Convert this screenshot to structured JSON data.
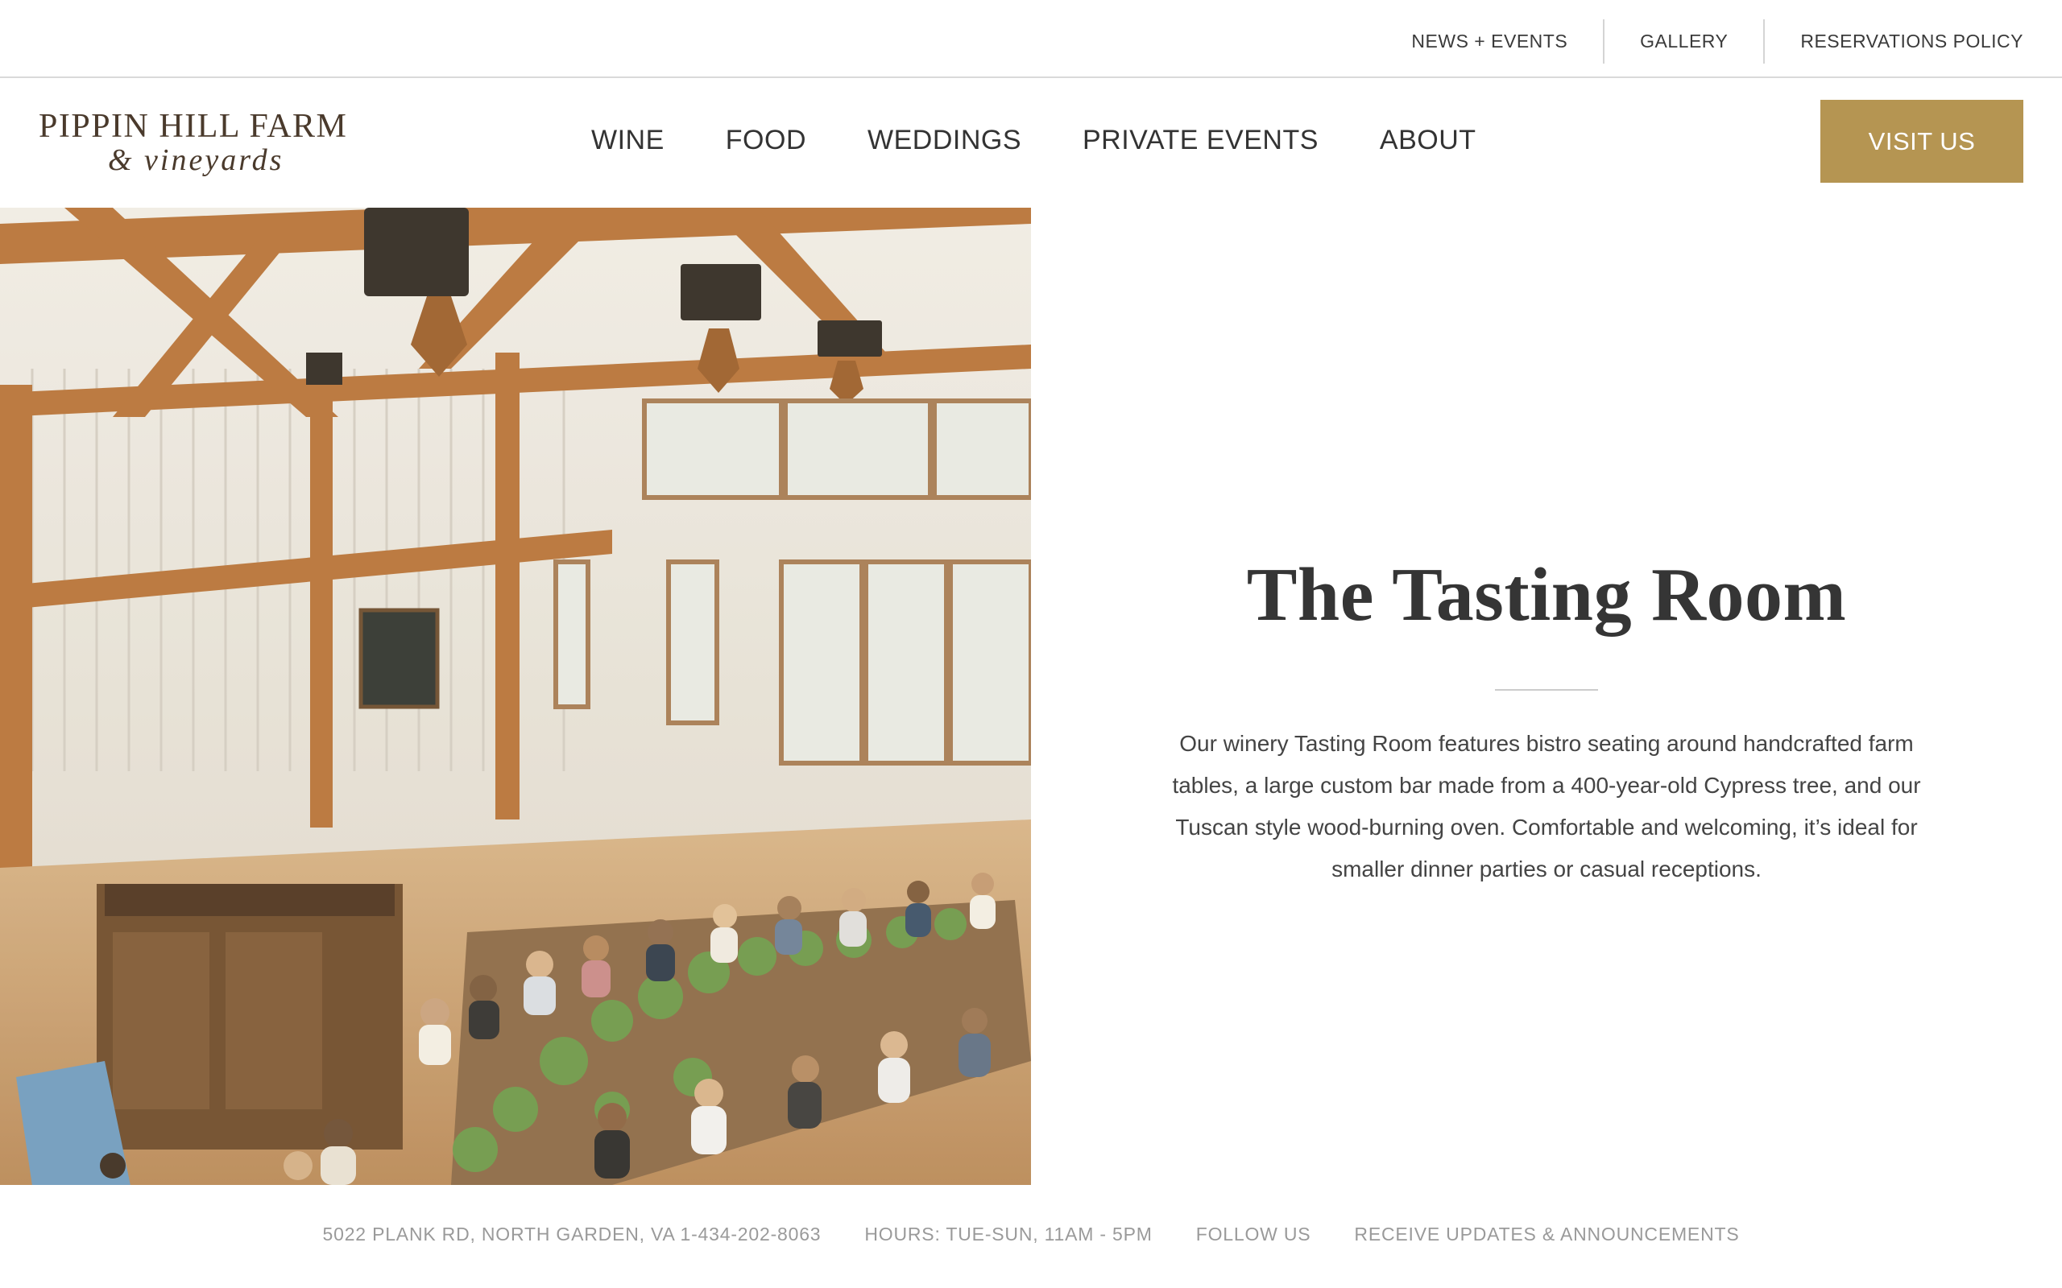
{
  "utility_nav": {
    "news_events": "NEWS + EVENTS",
    "gallery": "GALLERY",
    "reservations_policy": "RESERVATIONS POLICY"
  },
  "logo": {
    "line1": "PIPPIN HILL FARM",
    "line2": "& vineyards"
  },
  "primary_nav": {
    "items": [
      {
        "label": "WINE"
      },
      {
        "label": "FOOD"
      },
      {
        "label": "WEDDINGS"
      },
      {
        "label": "PRIVATE EVENTS"
      },
      {
        "label": "ABOUT"
      }
    ]
  },
  "visit_button": {
    "label": "VISIT US"
  },
  "hero": {
    "image_subject": "tasting room dining event photo"
  },
  "section": {
    "title": "The Tasting Room",
    "body": "Our winery Tasting Room features bistro seating around handcrafted farm tables, a large custom bar made from a 400-year-old Cypress tree, and our Tuscan style wood-burning oven. Comfortable and welcoming, it’s ideal for smaller dinner parties or casual receptions."
  },
  "footer": {
    "address": "5022 PLANK RD, NORTH GARDEN, VA 1-434-202-8063",
    "hours": "HOURS: TUE-SUN, 11AM - 5PM",
    "follow": "FOLLOW US",
    "updates": "RECEIVE UPDATES & ANNOUNCEMENTS"
  },
  "colors": {
    "accent": "#b59552",
    "text": "#353535",
    "muted": "#9a9a9a",
    "divider": "#d9d9d9"
  }
}
